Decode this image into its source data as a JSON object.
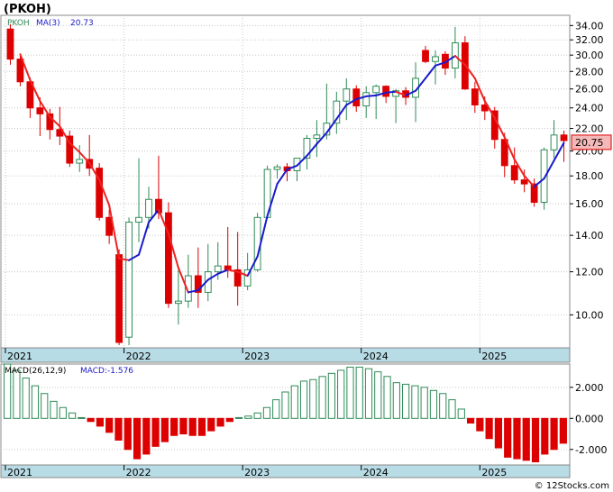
{
  "chart_data": [
    {
      "type": "candlestick",
      "title": "(PKOH)",
      "legend": [
        {
          "text": "PKOH",
          "color": "#2e8b57"
        },
        {
          "text": "MA(3)",
          "color": "#1a1acc"
        },
        {
          "text": "20.73",
          "color": "#1a1acc"
        }
      ],
      "price_tag": "20.75",
      "y_scale": "log",
      "ylim": [
        8.7,
        35.5
      ],
      "y_ticks": [
        "10.00",
        "12.00",
        "14.00",
        "16.00",
        "18.00",
        "20.00",
        "22.00",
        "24.00",
        "26.00",
        "28.00",
        "30.00",
        "32.00",
        "34.00"
      ],
      "x_ticks": [
        "2021",
        "2022",
        "2023",
        "2024",
        "2025"
      ],
      "colors": {
        "up": "#2e8b57",
        "down": "#dd0000",
        "ma": "#1a1acc",
        "ma_down": "#ee2222",
        "axis_bar": "#b8dce6"
      },
      "candles": [
        [
          33.5,
          34.2,
          28.8,
          29.5
        ],
        [
          29.5,
          30.2,
          26.3,
          26.8
        ],
        [
          26.8,
          27.3,
          23.0,
          24.0
        ],
        [
          24.0,
          25.1,
          21.3,
          23.4
        ],
        [
          23.4,
          23.9,
          21.0,
          21.9
        ],
        [
          21.9,
          24.1,
          20.5,
          21.3
        ],
        [
          21.3,
          21.8,
          18.7,
          19.0
        ],
        [
          19.0,
          20.5,
          18.3,
          19.3
        ],
        [
          19.3,
          21.4,
          18.0,
          18.6
        ],
        [
          18.6,
          19.0,
          14.9,
          15.1
        ],
        [
          15.1,
          15.6,
          13.5,
          14.0
        ],
        [
          12.9,
          13.2,
          8.8,
          8.9
        ],
        [
          9.1,
          15.1,
          8.8,
          14.8
        ],
        [
          14.8,
          19.4,
          13.6,
          15.1
        ],
        [
          15.1,
          17.2,
          14.4,
          16.3
        ],
        [
          16.3,
          19.6,
          15.0,
          15.4
        ],
        [
          15.4,
          16.1,
          10.3,
          10.5
        ],
        [
          10.5,
          12.1,
          9.6,
          10.6
        ],
        [
          10.6,
          12.9,
          10.3,
          11.8
        ],
        [
          11.8,
          13.3,
          10.3,
          11.0
        ],
        [
          11.0,
          13.5,
          10.6,
          12.0
        ],
        [
          12.0,
          13.6,
          11.6,
          12.3
        ],
        [
          12.3,
          14.5,
          11.7,
          12.1
        ],
        [
          12.1,
          14.2,
          10.4,
          11.3
        ],
        [
          11.3,
          13.0,
          11.1,
          12.1
        ],
        [
          12.1,
          15.4,
          12.0,
          15.1
        ],
        [
          15.1,
          18.8,
          15.0,
          18.5
        ],
        [
          18.5,
          18.9,
          17.8,
          18.7
        ],
        [
          18.7,
          19.0,
          17.6,
          18.4
        ],
        [
          18.4,
          19.2,
          17.6,
          19.4
        ],
        [
          19.4,
          21.4,
          18.5,
          21.1
        ],
        [
          21.1,
          22.8,
          19.5,
          21.4
        ],
        [
          21.4,
          26.6,
          21.0,
          22.5
        ],
        [
          22.5,
          25.7,
          21.5,
          24.7
        ],
        [
          24.7,
          27.2,
          22.8,
          26.0
        ],
        [
          26.0,
          26.4,
          23.6,
          24.2
        ],
        [
          24.2,
          26.3,
          23.0,
          25.6
        ],
        [
          25.6,
          26.5,
          22.9,
          26.3
        ],
        [
          26.3,
          26.4,
          24.5,
          25.2
        ],
        [
          25.2,
          26.0,
          22.5,
          25.8
        ],
        [
          25.8,
          26.2,
          24.3,
          25.1
        ],
        [
          25.1,
          29.1,
          22.6,
          27.2
        ],
        [
          30.6,
          31.2,
          29.0,
          29.2
        ],
        [
          29.2,
          30.6,
          26.5,
          29.8
        ],
        [
          30.1,
          30.5,
          27.6,
          28.4
        ],
        [
          28.4,
          33.8,
          27.2,
          31.6
        ],
        [
          31.6,
          32.5,
          25.9,
          26.0
        ],
        [
          26.0,
          26.8,
          23.5,
          24.3
        ],
        [
          24.3,
          25.2,
          22.8,
          23.7
        ],
        [
          23.7,
          24.1,
          20.2,
          21.0
        ],
        [
          21.0,
          21.6,
          17.9,
          18.8
        ],
        [
          18.8,
          20.3,
          17.4,
          17.7
        ],
        [
          17.7,
          18.5,
          16.8,
          17.4
        ],
        [
          17.4,
          17.8,
          15.8,
          16.1
        ],
        [
          16.1,
          20.3,
          15.6,
          20.1
        ],
        [
          20.1,
          22.8,
          19.4,
          21.4
        ],
        [
          21.4,
          21.8,
          19.1,
          20.9
        ]
      ],
      "ma3": [
        null,
        30.1,
        27.0,
        24.7,
        23.1,
        22.2,
        20.7,
        19.9,
        19.0,
        17.7,
        15.9,
        12.7,
        12.6,
        12.9,
        14.8,
        15.6,
        14.1,
        12.2,
        11.0,
        11.1,
        11.6,
        11.9,
        12.1,
        12.0,
        11.8,
        12.8,
        15.2,
        17.4,
        18.5,
        18.8,
        19.6,
        20.6,
        21.6,
        22.9,
        24.3,
        24.9,
        25.2,
        25.3,
        25.6,
        25.7,
        25.3,
        25.8,
        27.2,
        28.7,
        29.1,
        29.9,
        28.8,
        27.2,
        24.7,
        23.0,
        21.2,
        19.3,
        18.0,
        17.2,
        17.8,
        19.2,
        20.7
      ]
    },
    {
      "type": "bar",
      "title": "MACD(26,12,9)",
      "legend": [
        {
          "text": "MACD(26,12,9)",
          "color": "#000000"
        },
        {
          "text": "MACD:-1.576",
          "color": "#1a1acc"
        }
      ],
      "ylim": [
        -3.0,
        3.5
      ],
      "y_ticks": [
        {
          "value": 2,
          "label": "2.000"
        },
        {
          "value": 0,
          "label": "0.000"
        },
        {
          "value": -2,
          "label": "-2.000"
        }
      ],
      "x_ticks": [
        "2021",
        "2022",
        "2023",
        "2024",
        "2025"
      ],
      "values": [
        3.5,
        3.1,
        2.6,
        2.1,
        1.6,
        1.1,
        0.7,
        0.35,
        0.05,
        -0.2,
        -0.5,
        -0.9,
        -1.4,
        -2.0,
        -2.6,
        -2.3,
        -1.8,
        -1.5,
        -1.1,
        -1.0,
        -1.1,
        -1.1,
        -0.8,
        -0.5,
        -0.2,
        0.05,
        0.15,
        0.35,
        0.7,
        1.2,
        1.7,
        2.1,
        2.4,
        2.5,
        2.7,
        2.9,
        3.1,
        3.3,
        3.3,
        3.2,
        3.0,
        2.7,
        2.3,
        2.2,
        2.1,
        2.0,
        1.8,
        1.6,
        1.2,
        0.6,
        -0.3,
        -0.8,
        -1.3,
        -1.9,
        -2.5,
        -2.6,
        -2.7,
        -2.8,
        -2.3,
        -2.0,
        -1.6
      ]
    }
  ],
  "footer": "© 12Stocks.com"
}
